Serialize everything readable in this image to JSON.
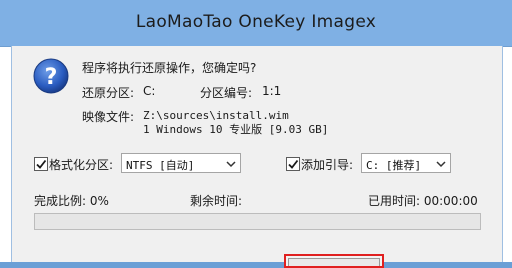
{
  "window": {
    "title": "LaoMaoTao OneKey Imagex"
  },
  "dialog": {
    "icon": "question-icon",
    "question": "程序将执行还原操作，您确定吗?",
    "restore_partition_label": "还原分区: ",
    "restore_partition_value": "C:",
    "partition_number_label": "分区编号: ",
    "partition_number_value": "1:1",
    "image_file_label": "映像文件: ",
    "image_file_path": "Z:\\sources\\install.wim",
    "image_file_desc": "1 Windows 10 专业版 [9.03 GB]"
  },
  "options": {
    "format_checkbox_label": "格式化分区:",
    "format_checked": true,
    "format_select_value": "NTFS [自动]",
    "boot_checkbox_label": "添加引导:",
    "boot_checked": true,
    "boot_select_value": "C: [推荐]"
  },
  "status": {
    "completion_label": "完成比例: 0%",
    "remaining_label": "剩余时间:",
    "elapsed_label": "已用时间: 00:00:00",
    "progress_fraction": 0
  },
  "colors": {
    "titlebar": "#7fb0e4",
    "highlight_border": "#e02020",
    "progress_fill": "#06b025"
  }
}
